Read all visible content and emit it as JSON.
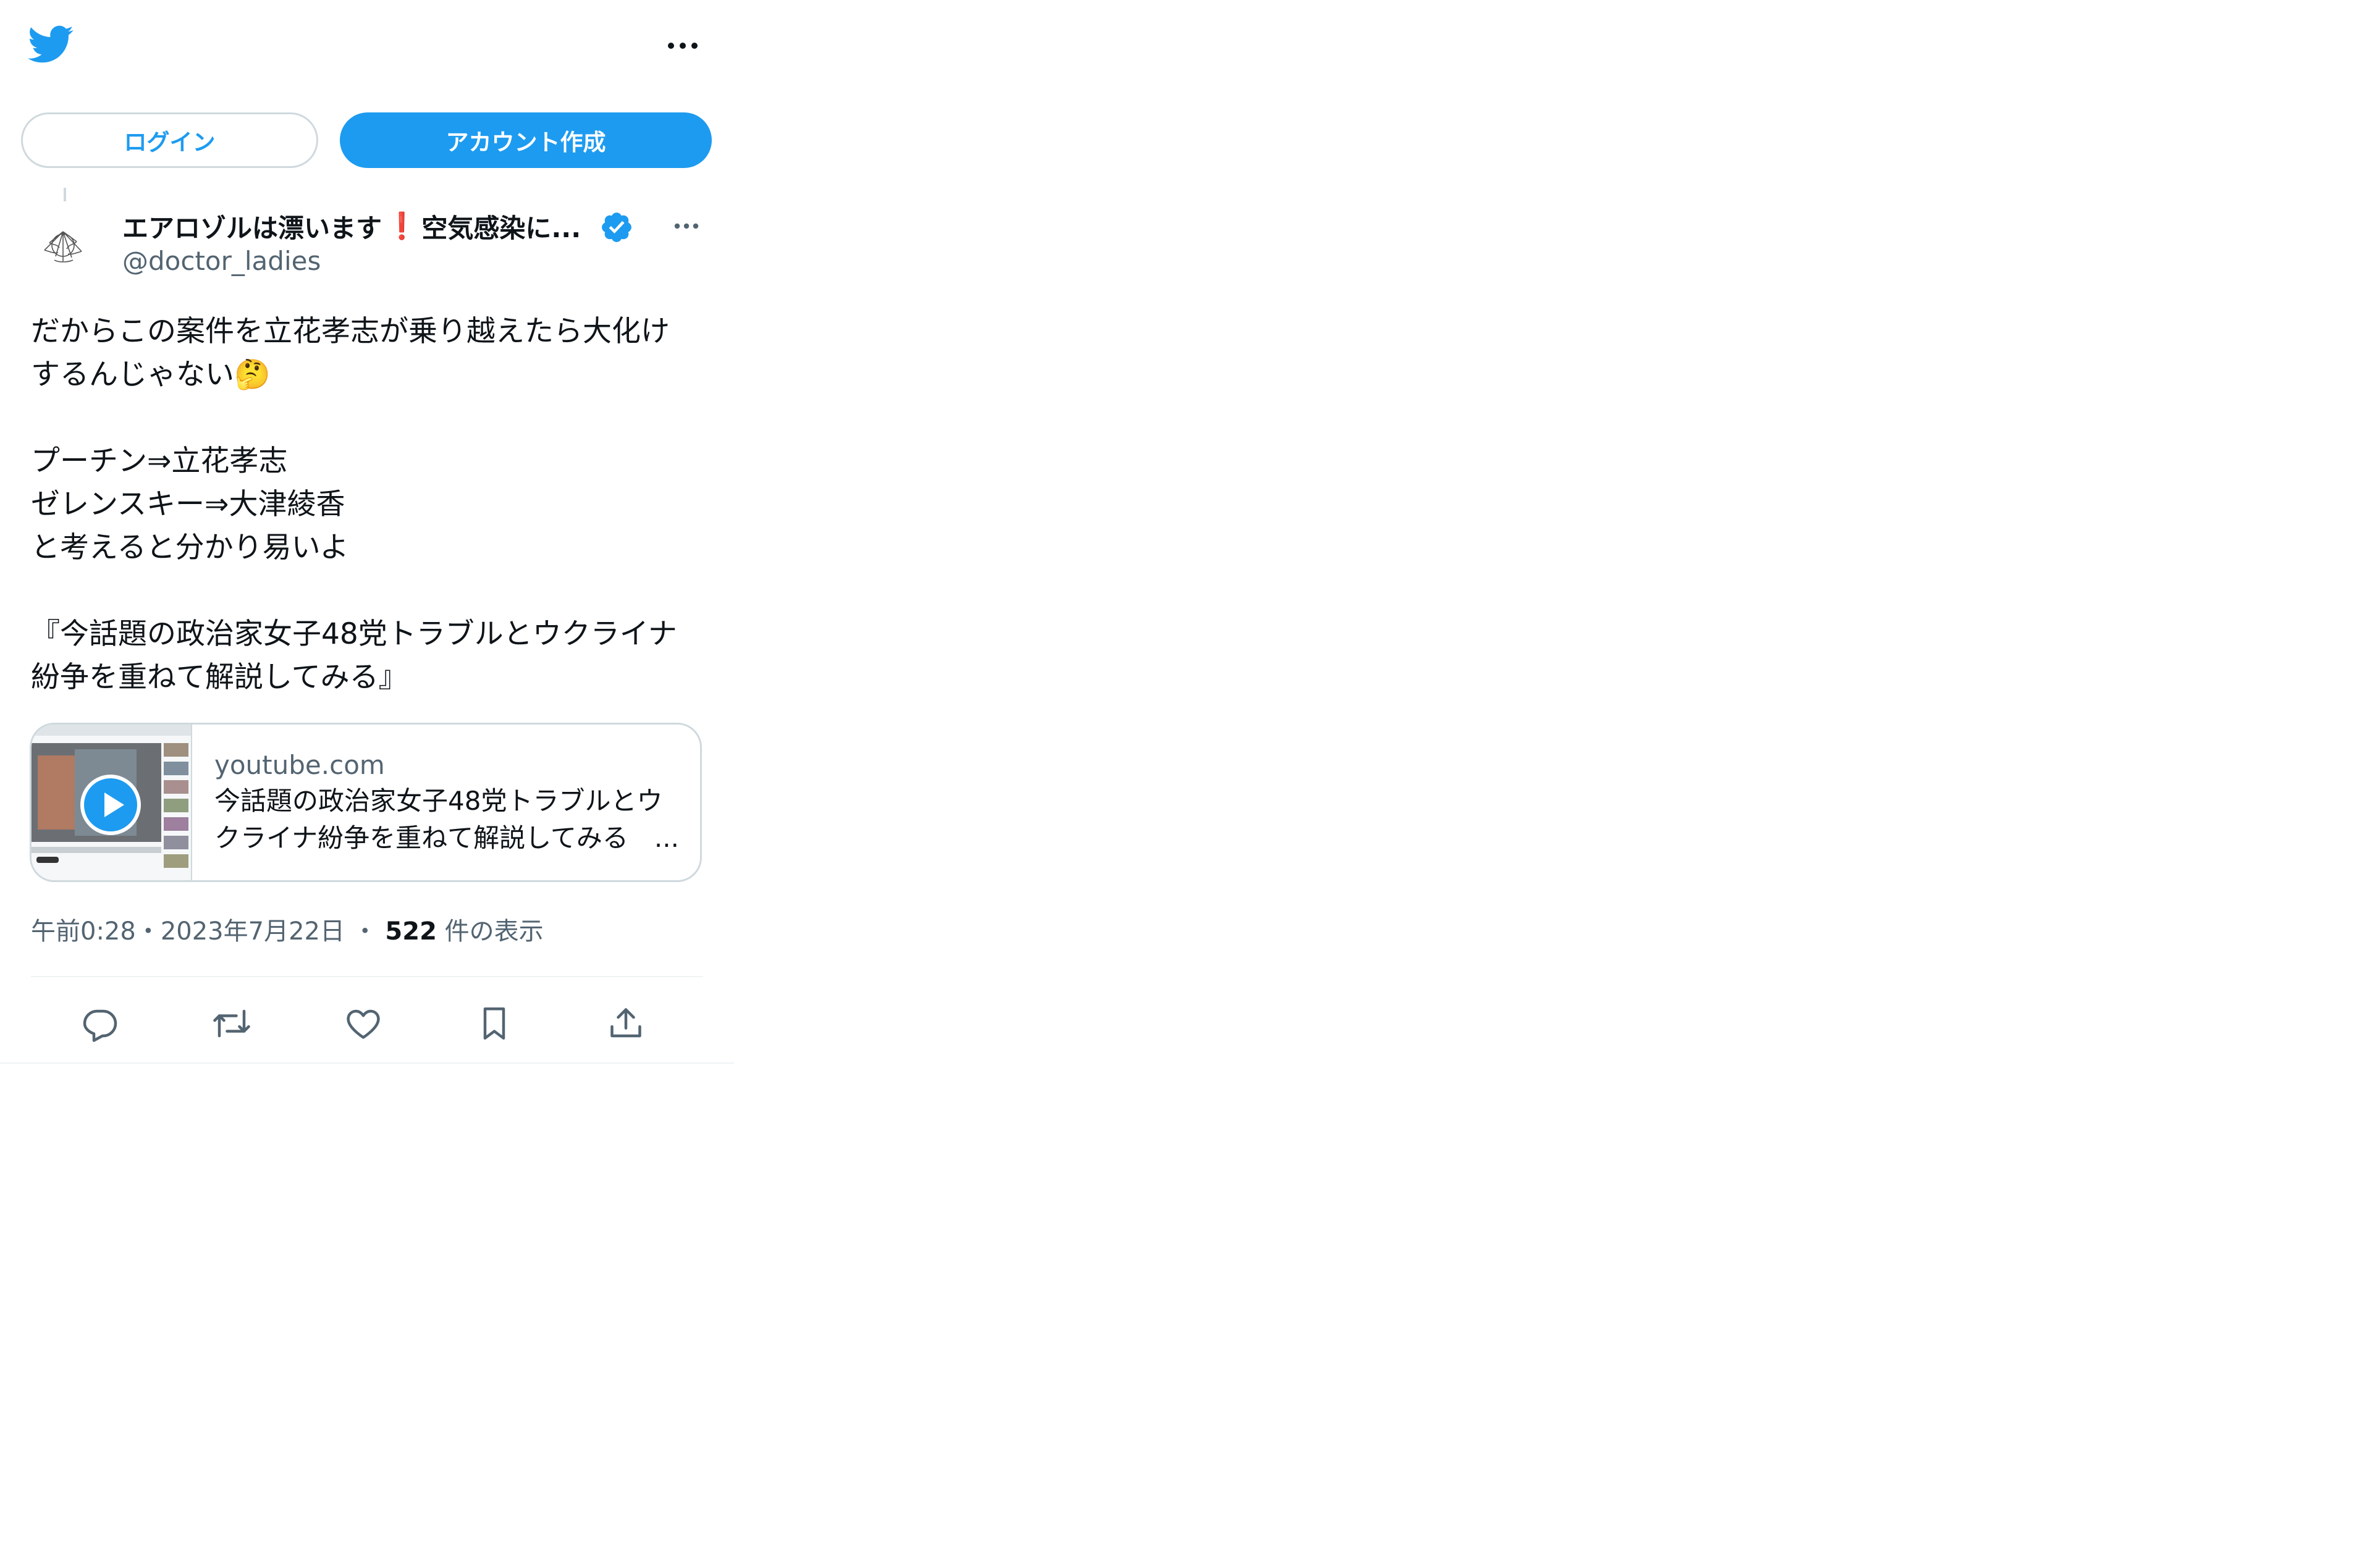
{
  "header": {
    "logo_icon": "twitter-bird-icon",
    "more_icon": "more-horizontal-icon"
  },
  "auth": {
    "login_label": "ログイン",
    "signup_label": "アカウント作成"
  },
  "tweet": {
    "author_name": "エアロゾルは漂います",
    "author_name_suffix": "空気感染に...",
    "author_name_emoji": "❗",
    "handle": "@doctor_ladies",
    "verified": true,
    "text": "だからこの案件を立花孝志が乗り越えたら大化け\nするんじゃない🤔\n\nプーチン⇒立花孝志\nゼレンスキー⇒大津綾香\nと考えると分かり易いよ\n\n『今話題の政治家女子48党トラブルとウクライナ\n紛争を重ねて解説してみる』",
    "card": {
      "domain": "youtube.com",
      "title": "今話題の政治家女子48党トラブルとウクライナ紛争を重ねて解説してみる",
      "title_line1": "今話題の政治家女子48党トラブルとウ",
      "title_line2": "クライナ紛争を重ねて解説してみる　...",
      "thumbnail_icon": "video-play-icon"
    },
    "time": "午前0:28",
    "separator1": "・",
    "date": "2023年7月22日",
    "separator2": "・",
    "views_count": "522",
    "views_label": "件の表示"
  },
  "actions": [
    "reply-icon",
    "retweet-icon",
    "like-icon",
    "bookmark-icon",
    "share-icon"
  ],
  "colors": {
    "accent": "#1d9bf0",
    "text_primary": "#0f1419",
    "text_secondary": "#536471",
    "border": "#cfd9de"
  }
}
